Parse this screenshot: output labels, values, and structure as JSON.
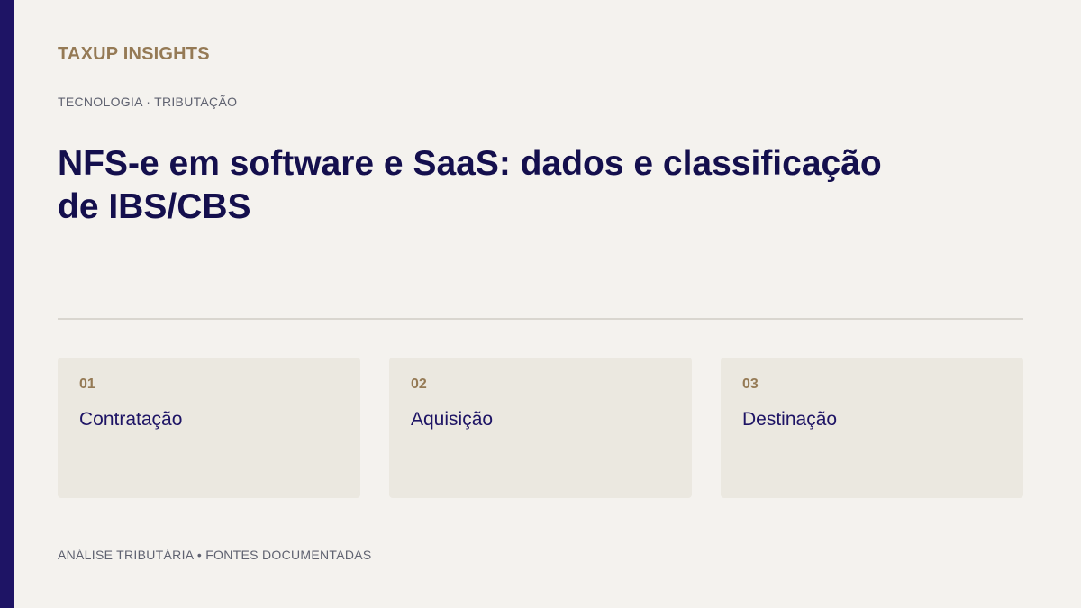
{
  "brand": "TAXUP INSIGHTS",
  "category": "TECNOLOGIA · TRIBUTAÇÃO",
  "title": "NFS-e em software e SaaS: dados e classificação de IBS/CBS",
  "cards": [
    {
      "number": "01",
      "label": "Contratação"
    },
    {
      "number": "02",
      "label": "Aquisição"
    },
    {
      "number": "03",
      "label": "Destinação"
    }
  ],
  "footer": "ANÁLISE TRIBUTÁRIA • FONTES DOCUMENTADAS",
  "colors": {
    "accent": "#1e1465",
    "gold": "#957a55",
    "background": "#f4f2ee",
    "card": "#ebe8e0"
  }
}
